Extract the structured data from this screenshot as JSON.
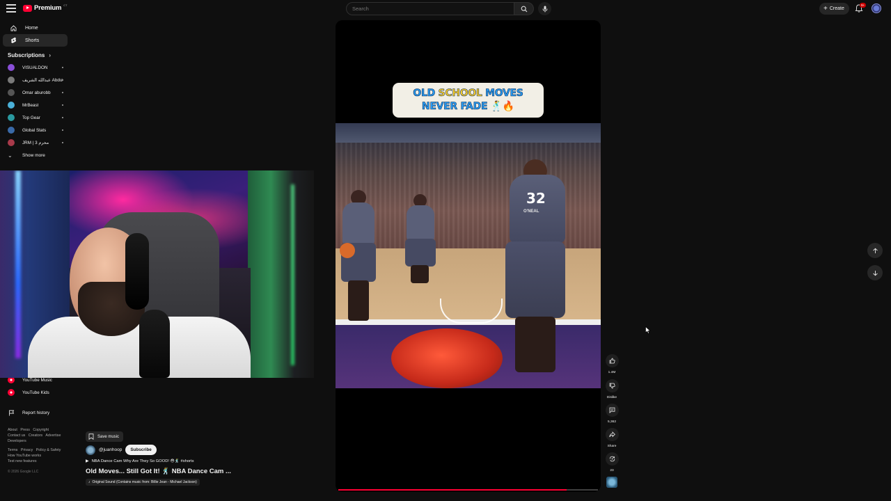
{
  "header": {
    "logo_text": "Premium",
    "logo_superscript": "CT",
    "search_placeholder": "Search",
    "create_label": "Create",
    "notification_badge": "9+"
  },
  "sidebar": {
    "nav": [
      {
        "label": "Home",
        "icon": "home-icon"
      },
      {
        "label": "Shorts",
        "icon": "shorts-icon",
        "active": true
      }
    ],
    "subscriptions_title": "Subscriptions",
    "subscriptions": [
      {
        "label": "VISUALDON",
        "color": "#8a4fd8"
      },
      {
        "label": "عبدالله الشريف Abdul...",
        "color": "#7a7a7a"
      },
      {
        "label": "Omar aburobb",
        "color": "#555555"
      },
      {
        "label": "MrBeast",
        "color": "#4ab0d8"
      },
      {
        "label": "Top Gear",
        "color": "#2a9aa0"
      },
      {
        "label": "Global Stats",
        "color": "#3a6aa8"
      },
      {
        "label": "JRM | محرم 3",
        "color": "#a83a4a"
      }
    ],
    "show_more": "Show more",
    "lower": [
      {
        "label": "YouTube Music",
        "color": "#ff0033"
      },
      {
        "label": "YouTube Kids",
        "color": "#ff0033"
      }
    ],
    "report_history": "Report history",
    "footer_links_1": [
      "About",
      "Press",
      "Copyright",
      "Contact us",
      "Creators",
      "Advertise",
      "Developers"
    ],
    "footer_links_2": [
      "Terms",
      "Privacy",
      "Policy & Safety",
      "How YouTube works",
      "Test new features"
    ],
    "copyright": "© 2026 Google LLC"
  },
  "short": {
    "banner_line1_a": "OLD ",
    "banner_line1_b": "SCHOOL",
    "banner_line1_c": " MOVES",
    "banner_line2": "NEVER FADE 🕺🔥",
    "jersey_number": "32",
    "jersey_name": "O'NEAL",
    "progress": 0.88
  },
  "actions": {
    "like_count": "1.4M",
    "dislike_label": "Dislike",
    "comment_count": "5,362",
    "share_label": "Share",
    "remix_count": "23"
  },
  "video_info": {
    "save_music": "Save music",
    "channel_handle": "@juanhoop",
    "subscribe_label": "Subscribe",
    "related_video": "NBA Dance Cam Why Are They So GOOD! 😳🕺 #shorts",
    "title": "Old Moves... Still Got It! 🕺 NBA Dance Cam ...",
    "sound": "Original Sound (Contains music from: Billie Jean - Michael Jackson)"
  }
}
